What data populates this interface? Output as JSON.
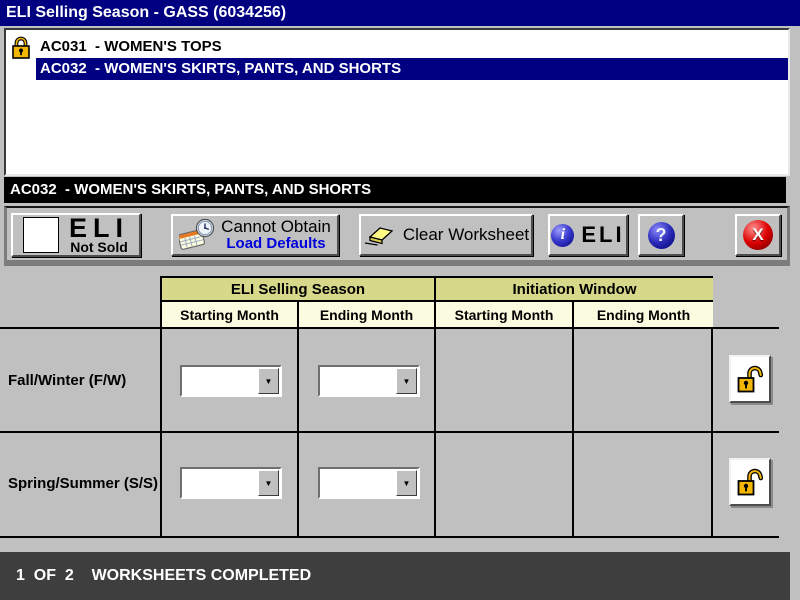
{
  "title_bar": {
    "title": "ELI Selling Season - GASS (6034256)"
  },
  "category_list": {
    "items": [
      {
        "text": "AC031  - WOMEN'S TOPS",
        "selected": false,
        "locked": true
      },
      {
        "text": "AC032  - WOMEN'S SKIRTS, PANTS, AND SHORTS",
        "selected": true,
        "locked": false
      }
    ]
  },
  "selected_category_bar": {
    "text": "AC032  - WOMEN'S SKIRTS, PANTS, AND SHORTS"
  },
  "toolbar": {
    "eli_not_sold_button": {
      "line1": "ELI",
      "line2": "Not Sold"
    },
    "cannot_obtain_button": {
      "line1": "Cannot Obtain",
      "line2": "Load Defaults"
    },
    "clear_worksheet_button": {
      "label": "Clear Worksheet"
    },
    "eli_info_button": {
      "label": "ELI",
      "icon_glyph": "i"
    },
    "help_button": {
      "glyph": "?"
    },
    "close_button": {
      "glyph": "X"
    }
  },
  "worksheet": {
    "group_headers": [
      "ELI Selling Season",
      "Initiation Window"
    ],
    "column_headers": [
      "Starting Month",
      "Ending Month",
      "Starting Month",
      "Ending Month"
    ],
    "rows": [
      {
        "label": "Fall/Winter (F/W)",
        "eli_starting_month": "",
        "eli_ending_month": ""
      },
      {
        "label": "Spring/Summer (S/S)",
        "eli_starting_month": "",
        "eli_ending_month": ""
      }
    ]
  },
  "status_bar": {
    "text": "1  OF  2    WORKSHEETS COMPLETED"
  },
  "icons": {
    "list_lock": "closed-padlock-icon",
    "row_lock": "open-padlock-icon",
    "cannot_obtain": "keyboard-clock-icon",
    "clear": "eraser-icon",
    "info": "info-sphere-icon",
    "help": "question-sphere-icon",
    "close": "close-x-sphere-icon"
  },
  "colors": {
    "title_bar": "#000080",
    "selection": "#000080",
    "group_header": "#D8D88A",
    "column_header": "#FBFBE0",
    "status_bar": "#3E3E3E",
    "link_blue": "#0000DD",
    "close_red": "#DD0000",
    "lock_gold": "#F2B705"
  }
}
